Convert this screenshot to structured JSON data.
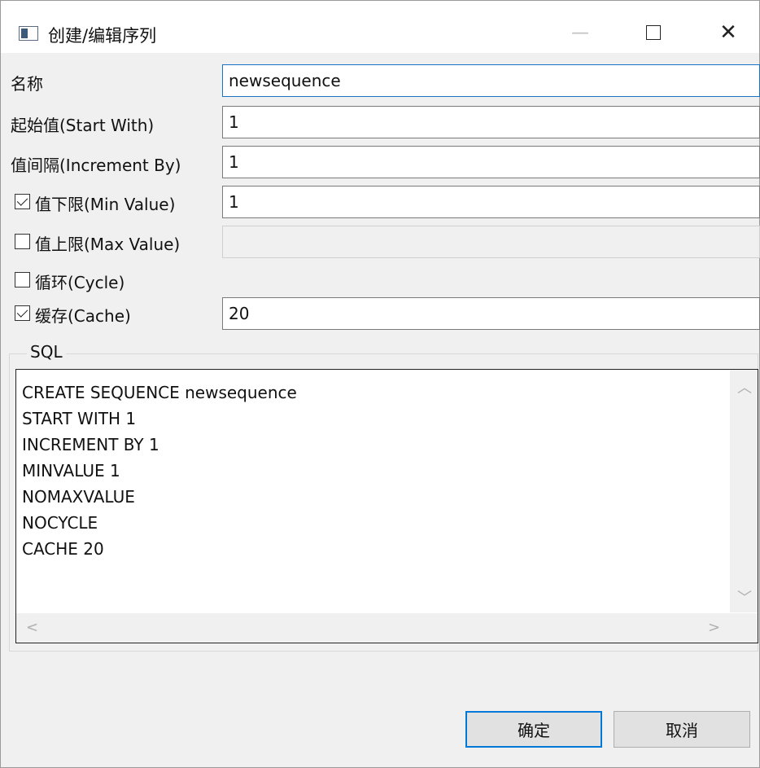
{
  "window": {
    "title": "创建/编辑序列",
    "minimize_glyph": "—",
    "close_glyph": "✕"
  },
  "form": {
    "name": {
      "label": "名称",
      "value": "newsequence"
    },
    "start_with": {
      "label": "起始值(Start With)",
      "value": "1"
    },
    "increment_by": {
      "label": "值间隔(Increment By)",
      "value": "1"
    },
    "min_value": {
      "label": "值下限(Min Value)",
      "checked": true,
      "value": "1"
    },
    "max_value": {
      "label": "值上限(Max Value)",
      "checked": false,
      "value": ""
    },
    "cycle": {
      "label": "循环(Cycle)",
      "checked": false
    },
    "cache": {
      "label": "缓存(Cache)",
      "checked": true,
      "value": "20"
    }
  },
  "sql": {
    "legend": "SQL",
    "text": "CREATE SEQUENCE newsequence\nSTART WITH 1\nINCREMENT BY 1\nMINVALUE 1\nNOMAXVALUE\nNOCYCLE\nCACHE 20"
  },
  "buttons": {
    "ok": "确定",
    "cancel": "取消"
  },
  "icons": {
    "app": "window-app-icon",
    "scroll_up": "chevron-up-icon",
    "scroll_down": "chevron-down-icon",
    "scroll_left": "chevron-left-icon",
    "scroll_right": "chevron-right-icon"
  },
  "colors": {
    "accent": "#0078d7",
    "focus_border": "#1a72c6",
    "dialog_bg": "#f0f0f0"
  }
}
